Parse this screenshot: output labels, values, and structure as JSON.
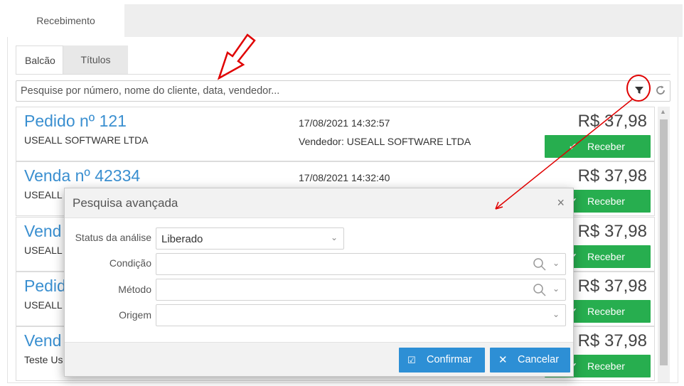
{
  "top_tab": {
    "label": "Recebimento"
  },
  "subtabs": [
    {
      "label": "Balcão"
    },
    {
      "label": "Títulos"
    }
  ],
  "search": {
    "placeholder": "Pesquise por número, nome do cliente, data, vendedor..."
  },
  "list": {
    "items": [
      {
        "title": "Pedido nº 121",
        "client": "USEALL SOFTWARE LTDA",
        "date": "17/08/2021 14:32:57",
        "seller": "Vendedor: USEALL SOFTWARE LTDA",
        "price": "R$ 37,98",
        "button": "Receber"
      },
      {
        "title": "Venda nº 42334",
        "client": "USEALL",
        "date": "17/08/2021 14:32:40",
        "seller": "",
        "price": "R$ 37,98",
        "button": "Receber"
      },
      {
        "title": "Vend",
        "client": "USEALL",
        "date": "",
        "seller": "",
        "price": "R$ 37,98",
        "button": "Receber"
      },
      {
        "title": "Pedid",
        "client": "USEALL",
        "date": "",
        "seller": "",
        "price": "R$ 37,98",
        "button": "Receber"
      },
      {
        "title": "Vend",
        "client": "Teste Us",
        "date": "",
        "seller": "",
        "price": "R$ 37,98",
        "button": "Receber"
      }
    ]
  },
  "modal": {
    "title": "Pesquisa avançada",
    "close": "×",
    "fields": {
      "status_label": "Status da análise",
      "status_value": "Liberado",
      "condicao_label": "Condição",
      "metodo_label": "Método",
      "origem_label": "Origem"
    },
    "confirm_label": "Confirmar",
    "cancel_label": "Cancelar"
  },
  "colors": {
    "accent_blue": "#2d8fd5",
    "success_green": "#27ae4f",
    "link_blue": "#3a8fd0",
    "annotation_red": "#e00000"
  },
  "icons": [
    "filter-icon",
    "refresh-icon",
    "check-icon",
    "search-icon",
    "chevron-down-icon",
    "close-icon",
    "edit-check-icon"
  ]
}
